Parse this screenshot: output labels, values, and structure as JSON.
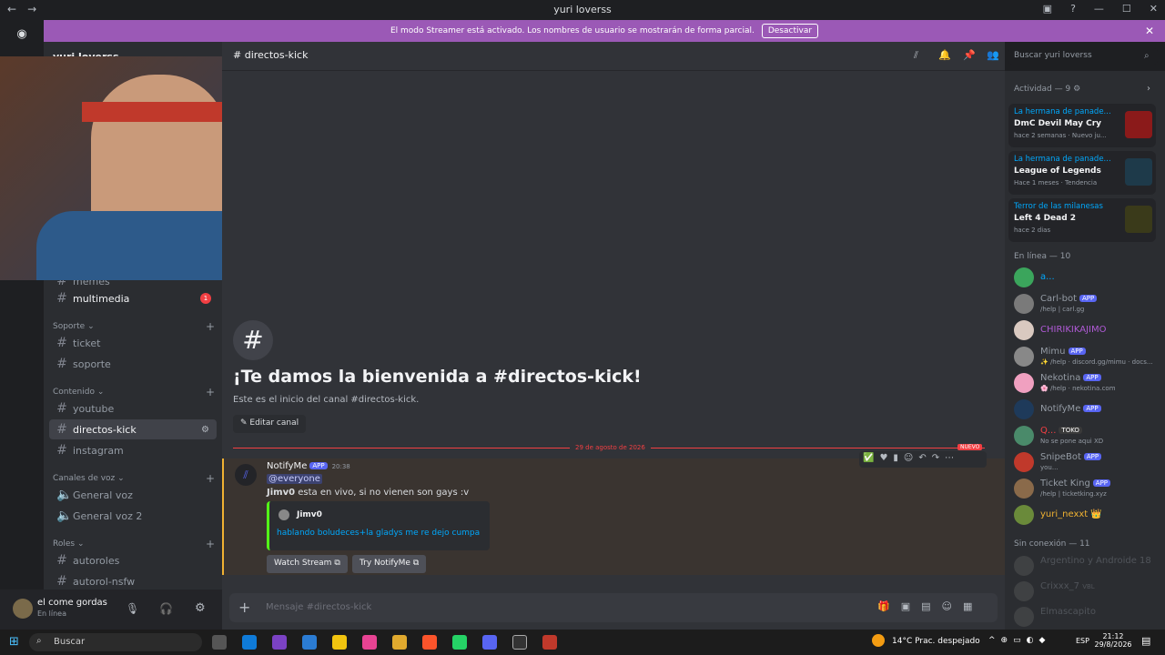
{
  "window": {
    "title": "yuri loverss"
  },
  "banner": {
    "text": "El modo Streamer está activado. Los nombres de usuario se mostrarán de forma parcial.",
    "button": "Desactivar"
  },
  "server": {
    "name": "yuri loverss"
  },
  "channel": {
    "name": "directos-kick"
  },
  "search": {
    "placeholder": "Buscar yuri loverss"
  },
  "sidebar": {
    "partial_item": "memes",
    "items": [
      {
        "label": "multimedia",
        "badge": "1"
      },
      {
        "category": "Soporte"
      },
      {
        "label": "ticket"
      },
      {
        "label": "soporte"
      },
      {
        "category": "Contenido"
      },
      {
        "label": "youtube"
      },
      {
        "label": "directos-kick"
      },
      {
        "label": "instagram"
      },
      {
        "category": "Canales de voz"
      },
      {
        "label": "General voz"
      },
      {
        "label": "General voz 2"
      },
      {
        "category": "Roles"
      },
      {
        "label": "autoroles"
      },
      {
        "label": "autorol-nsfw"
      }
    ]
  },
  "user": {
    "name": "el come gordas",
    "status": "En línea"
  },
  "welcome": {
    "title": "¡Te damos la bienvenida a #directos-kick!",
    "subtitle": "Este es el inicio del canal #directos-kick.",
    "edit_button": "Editar canal"
  },
  "divider": {
    "date": "29 de agosto de 2026",
    "new_label": "NUEVO"
  },
  "message": {
    "author": "NotifyMe",
    "app_tag": "APP",
    "time": "20:38",
    "mention": "@everyone",
    "text_bold": "Jimv0",
    "text": " esta en vivo, si no vienen son gays :v",
    "embed_author": "Jimv0",
    "embed_title": "hablando boludeces+la gladys me re dejo cumpa",
    "buttons": [
      "Watch Stream",
      "Try NotifyMe"
    ]
  },
  "composer": {
    "placeholder": "Mensaje #directos-kick"
  },
  "activity": {
    "header": "Actividad — 9",
    "cards": [
      {
        "who": "La hermana de panade...",
        "game": "DmC Devil May Cry",
        "meta": "hace 2 semanas · Nuevo ju..."
      },
      {
        "who": "La hermana de panade...",
        "game": "League of Legends",
        "meta": "Hace 1 meses · Tendencia"
      },
      {
        "who": "Terror de las milanesas",
        "game": "Left 4 Dead 2",
        "meta": "hace 2 dias"
      }
    ]
  },
  "online": {
    "header": "En línea — 10",
    "members": [
      {
        "name": "a...",
        "sub": "",
        "color": "#00a8fc",
        "tag": ""
      },
      {
        "name": "Carl-bot",
        "sub": "/help | carl.gg",
        "color": "#949ba4",
        "tag": "APP"
      },
      {
        "name": "CHIRIKIKAJIMO",
        "sub": "",
        "color": "#b05ad6",
        "tag": ""
      },
      {
        "name": "Mimu",
        "sub": "✨ /help · discord.gg/mimu · docs...",
        "color": "#949ba4",
        "tag": "APP"
      },
      {
        "name": "Nekotina",
        "sub": "🌸 /help · nekotina.com",
        "color": "#949ba4",
        "tag": "APP"
      },
      {
        "name": "NotifyMe",
        "sub": "",
        "color": "#949ba4",
        "tag": "APP"
      },
      {
        "name": "Q...",
        "sub": "No se pone aqui XD",
        "color": "#f23f43",
        "tag": "TOKO"
      },
      {
        "name": "SnipeBot",
        "sub": "you...",
        "color": "#949ba4",
        "tag": "APP"
      },
      {
        "name": "Ticket King",
        "sub": "/help | ticketking.xyz",
        "color": "#949ba4",
        "tag": "APP"
      },
      {
        "name": "yuri_nexxt 👑",
        "sub": "",
        "color": "#f0b232",
        "tag": ""
      }
    ]
  },
  "offline": {
    "header": "Sin conexión — 11",
    "members": [
      {
        "name": "Argentino y Androide 18"
      },
      {
        "name": "Crixxx_7",
        "tag": "VBL"
      },
      {
        "name": "Elmascapito"
      }
    ]
  },
  "taskbar": {
    "search": "Buscar",
    "weather": "14°C  Prac. despejado",
    "lang": "ESP",
    "time": "21:12",
    "date": "29/8/2026"
  }
}
